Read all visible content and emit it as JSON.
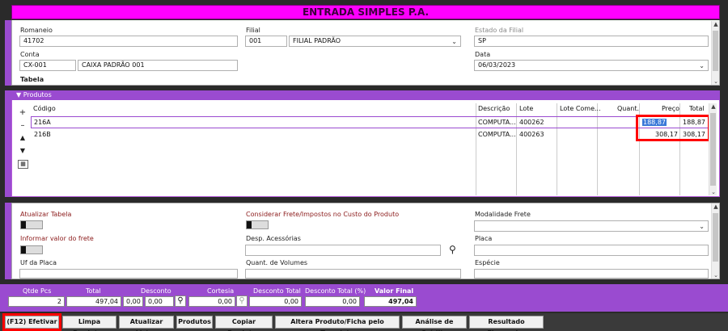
{
  "title": "ENTRADA SIMPLES P.A.",
  "header": {
    "romaneio_label": "Romaneio",
    "romaneio_value": "41702",
    "filial_label": "Filial",
    "filial_code": "001",
    "filial_name": "FILIAL PADRÃO",
    "estado_label": "Estado da Filial",
    "estado_value": "SP",
    "conta_label": "Conta",
    "conta_code": "CX-001",
    "conta_name": "CAIXA PADRÃO 001",
    "data_label": "Data",
    "data_value": "06/03/2023",
    "tabela_label": "Tabela"
  },
  "produtos": {
    "section_label": "Produtos",
    "columns": {
      "codigo": "Código",
      "descricao": "Descrição",
      "lote": "Lote",
      "lote_comercial": "Lote Come...",
      "quant": "Quant.",
      "preco": "Preço",
      "total": "Total"
    },
    "rows": [
      {
        "codigo": "216A",
        "descricao": "COMPUTA...",
        "lote": "400262",
        "preco": "188,87",
        "total": "188,87"
      },
      {
        "codigo": "216B",
        "descricao": "COMPUTA...",
        "lote": "400263",
        "preco": "308,17",
        "total": "308,17"
      }
    ]
  },
  "options": {
    "atualizar_tabela": "Atualizar Tabela",
    "considerar_frete": "Considerar Frete/Impostos no Custo do Produto",
    "modalidade_frete": "Modalidade Frete",
    "informar_frete": "Informar valor do frete",
    "desp_acessorias": "Desp. Acessórias",
    "placa": "Placa",
    "uf_placa": "Uf da Placa",
    "quant_volumes": "Quant. de Volumes",
    "especie": "Espécie"
  },
  "totals": {
    "qtde_pcs_label": "Qtde Pcs",
    "qtde_pcs": "2",
    "total_label": "Total",
    "total": "497,04",
    "desconto_label": "Desconto",
    "desconto_a": "0,00",
    "desconto_b": "0,00",
    "cortesia_label": "Cortesia",
    "cortesia": "0,00",
    "desconto_total_label": "Desconto Total",
    "desconto_total": "0,00",
    "desconto_total_pct_label": "Desconto Total (%)",
    "desconto_total_pct": "0,00",
    "valor_final_label": "Valor Final",
    "valor_final": "497,04"
  },
  "footer": {
    "efetivar": "(F12) Efetivar",
    "limpa": "Limpa Produtos",
    "atualizar_listas": "Atualizar Listas",
    "produtos": "Produtos",
    "copiar": "Copiar Produtos",
    "altera": "Altera Produto/Ficha pelo Template",
    "analise": "Análise de Crédito",
    "resultado": "Resultado Financeiro"
  },
  "colors": {
    "title_bg": "#ff00ff",
    "accent_purple": "#9a4bd0",
    "highlight_red": "#ff0000",
    "selection_blue": "#3a78d8"
  },
  "icons": [
    "search-icon",
    "plus-icon",
    "minus-icon",
    "arrow-up-icon",
    "arrow-down-icon",
    "grid-icon",
    "chevron-down-icon"
  ]
}
